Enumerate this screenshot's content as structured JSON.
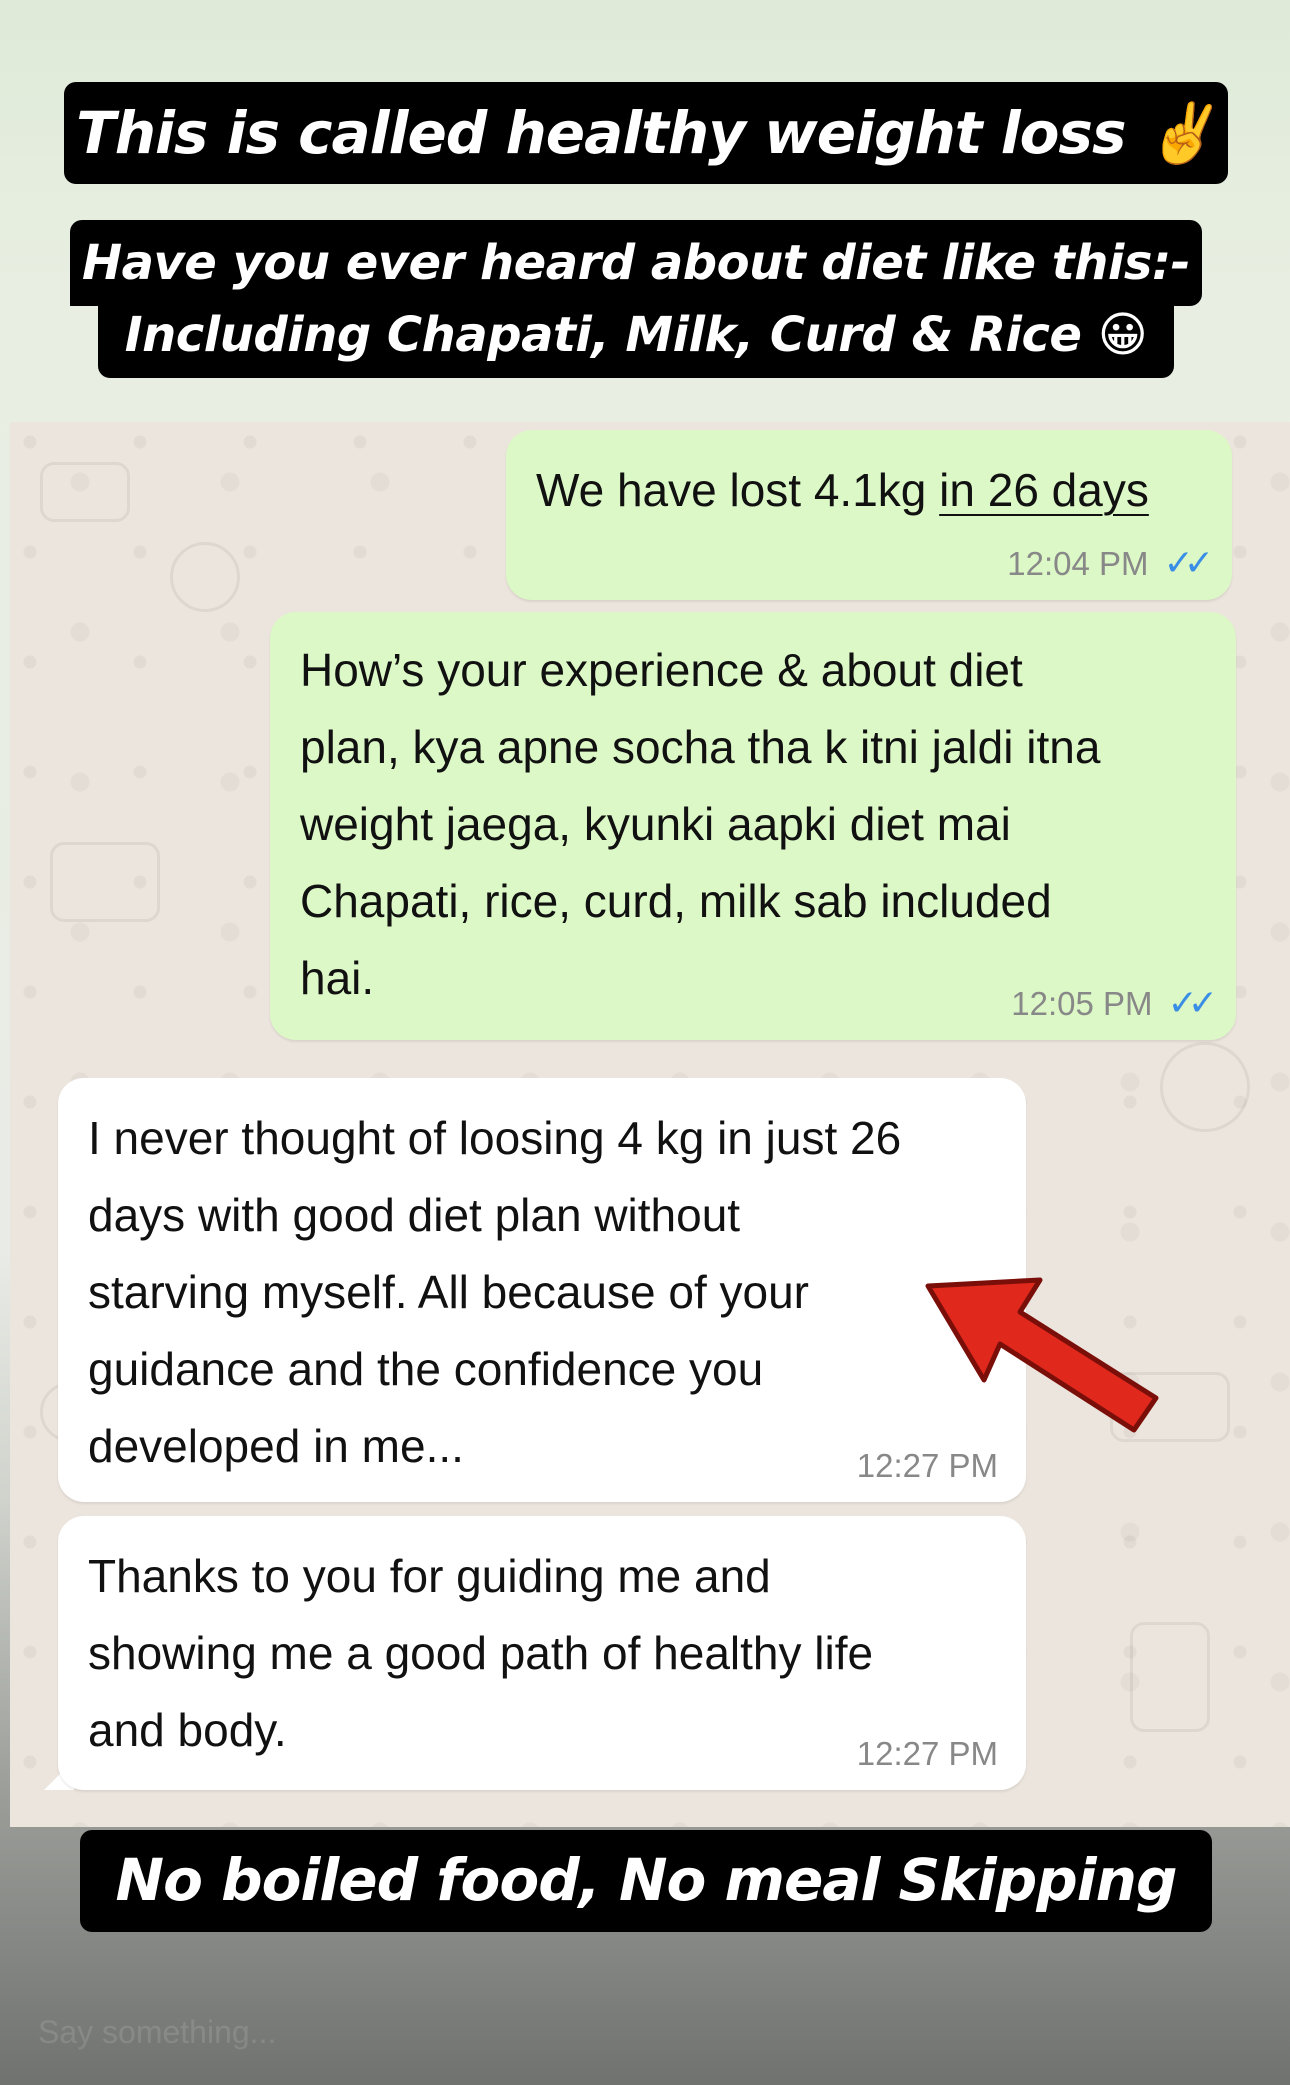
{
  "banners": {
    "top": "This is called healthy weight loss ✌️",
    "sub_line_1": "Have you ever heard about diet like this:-",
    "sub_line_2": "Including Chapati, Milk, Curd & Rice 😀",
    "bottom": "No boiled food, No meal Skipping"
  },
  "messages": [
    {
      "direction": "outgoing",
      "text_before": "We have lost 4.1kg ",
      "text_underlined": "in 26 days",
      "time": "12:04 PM",
      "status": "read"
    },
    {
      "direction": "outgoing",
      "text": "How’s your experience & about diet\nplan, kya apne socha tha k itni jaldi itna\nweight jaega, kyunki aapki diet mai\nChapati, rice, curd, milk sab included\nhai.",
      "time": "12:05 PM",
      "status": "read"
    },
    {
      "direction": "incoming",
      "text": "I never thought of loosing 4 kg in just 26\ndays with good diet plan without\nstarving myself. All because of your\nguidance and the confidence you\ndeveloped in me...",
      "time": "12:27 PM"
    },
    {
      "direction": "incoming",
      "text": "Thanks to you for guiding me and\nshowing me a good path of healthy life\nand body.",
      "time": "12:27 PM"
    }
  ],
  "read_ticks": "✓✓",
  "reply": {
    "placeholder": "Say something..."
  },
  "colors": {
    "outgoing_bubble": "#dcf8c6",
    "incoming_bubble": "#ffffff",
    "read_tick": "#3a8ee6",
    "arrow": "#e0281c"
  }
}
